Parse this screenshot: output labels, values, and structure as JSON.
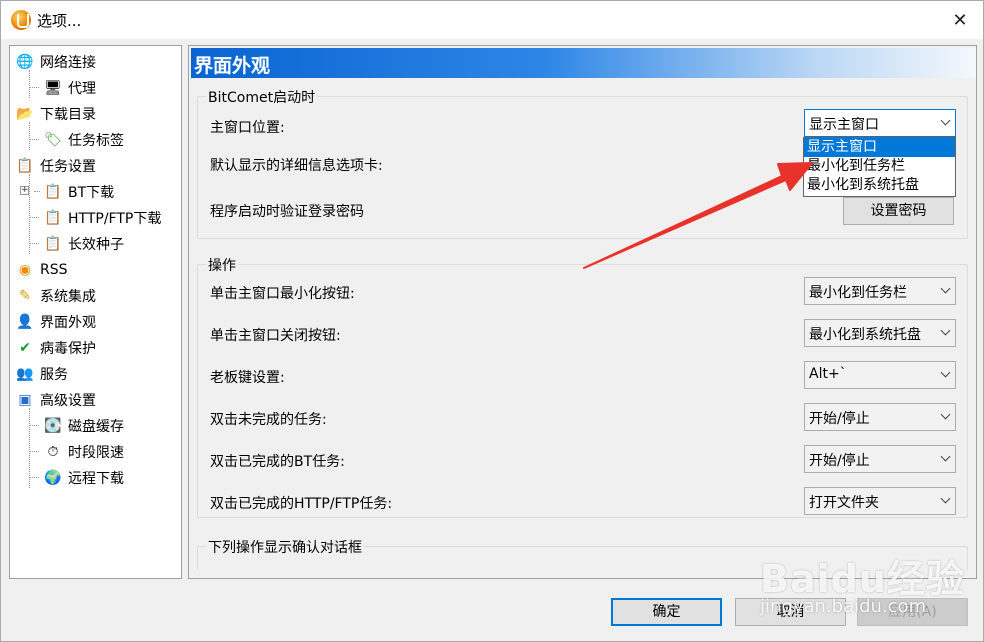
{
  "window": {
    "title": "选项..."
  },
  "tree": [
    {
      "label": "网络连接",
      "icon": "globe-network-icon",
      "level": 0
    },
    {
      "label": "代理",
      "icon": "proxy-computer-icon",
      "level": 1
    },
    {
      "label": "下载目录",
      "icon": "folder-icon",
      "level": 0
    },
    {
      "label": "任务标签",
      "icon": "tag-icon",
      "level": 1
    },
    {
      "label": "任务设置",
      "icon": "clipboard-check-icon",
      "level": 0
    },
    {
      "label": "BT下载",
      "icon": "clipboard-check-icon",
      "level": 1
    },
    {
      "label": "HTTP/FTP下载",
      "icon": "clipboard-check-icon",
      "level": 1
    },
    {
      "label": "长效种子",
      "icon": "clipboard-check-icon",
      "level": 1
    },
    {
      "label": "RSS",
      "icon": "rss-icon",
      "level": 0
    },
    {
      "label": "系统集成",
      "icon": "puzzle-icon",
      "level": 0
    },
    {
      "label": "界面外观",
      "icon": "monitor-user-icon",
      "level": 0
    },
    {
      "label": "病毒保护",
      "icon": "shield-check-icon",
      "level": 0
    },
    {
      "label": "服务",
      "icon": "users-icon",
      "level": 0
    },
    {
      "label": "高级设置",
      "icon": "advanced-settings-icon",
      "level": 0
    },
    {
      "label": "磁盘缓存",
      "icon": "disk-cache-icon",
      "level": 1
    },
    {
      "label": "时段限速",
      "icon": "time-limit-icon",
      "level": 1
    },
    {
      "label": "远程下载",
      "icon": "remote-globe-icon",
      "level": 1
    }
  ],
  "panel": {
    "title": "界面外观",
    "startup_group": {
      "title": "BitComet启动时",
      "main_window_label": "主窗口位置:",
      "main_window_value": "显示主窗口",
      "detail_tab_label": "默认显示的详细信息选项卡:",
      "password_label": "程序启动时验证登录密码",
      "password_button": "设置密码"
    },
    "dropdown_options": [
      "显示主窗口",
      "最小化到任务栏",
      "最小化到系统托盘"
    ],
    "ops_group": {
      "title": "操作",
      "rows": [
        {
          "label": "单击主窗口最小化按钮:",
          "value": "最小化到任务栏"
        },
        {
          "label": "单击主窗口关闭按钮:",
          "value": "最小化到系统托盘"
        },
        {
          "label": "老板键设置:",
          "value": "Alt+`"
        },
        {
          "label": "双击未完成的任务:",
          "value": "开始/停止"
        },
        {
          "label": "双击已完成的BT任务:",
          "value": "开始/停止"
        },
        {
          "label": "双击已完成的HTTP/FTP任务:",
          "value": "打开文件夹"
        }
      ]
    },
    "confirm_group": {
      "title": "下列操作显示确认对话框"
    }
  },
  "buttons": {
    "ok": "确定",
    "cancel": "取消",
    "apply": "应用(A)"
  },
  "watermark": {
    "main": "Baidu经验",
    "sub": "jingyan.baidu.com"
  },
  "colors": {
    "accent": "#0078d7",
    "header_start": "#0a64d2",
    "annotation_arrow": "#e8322b"
  }
}
